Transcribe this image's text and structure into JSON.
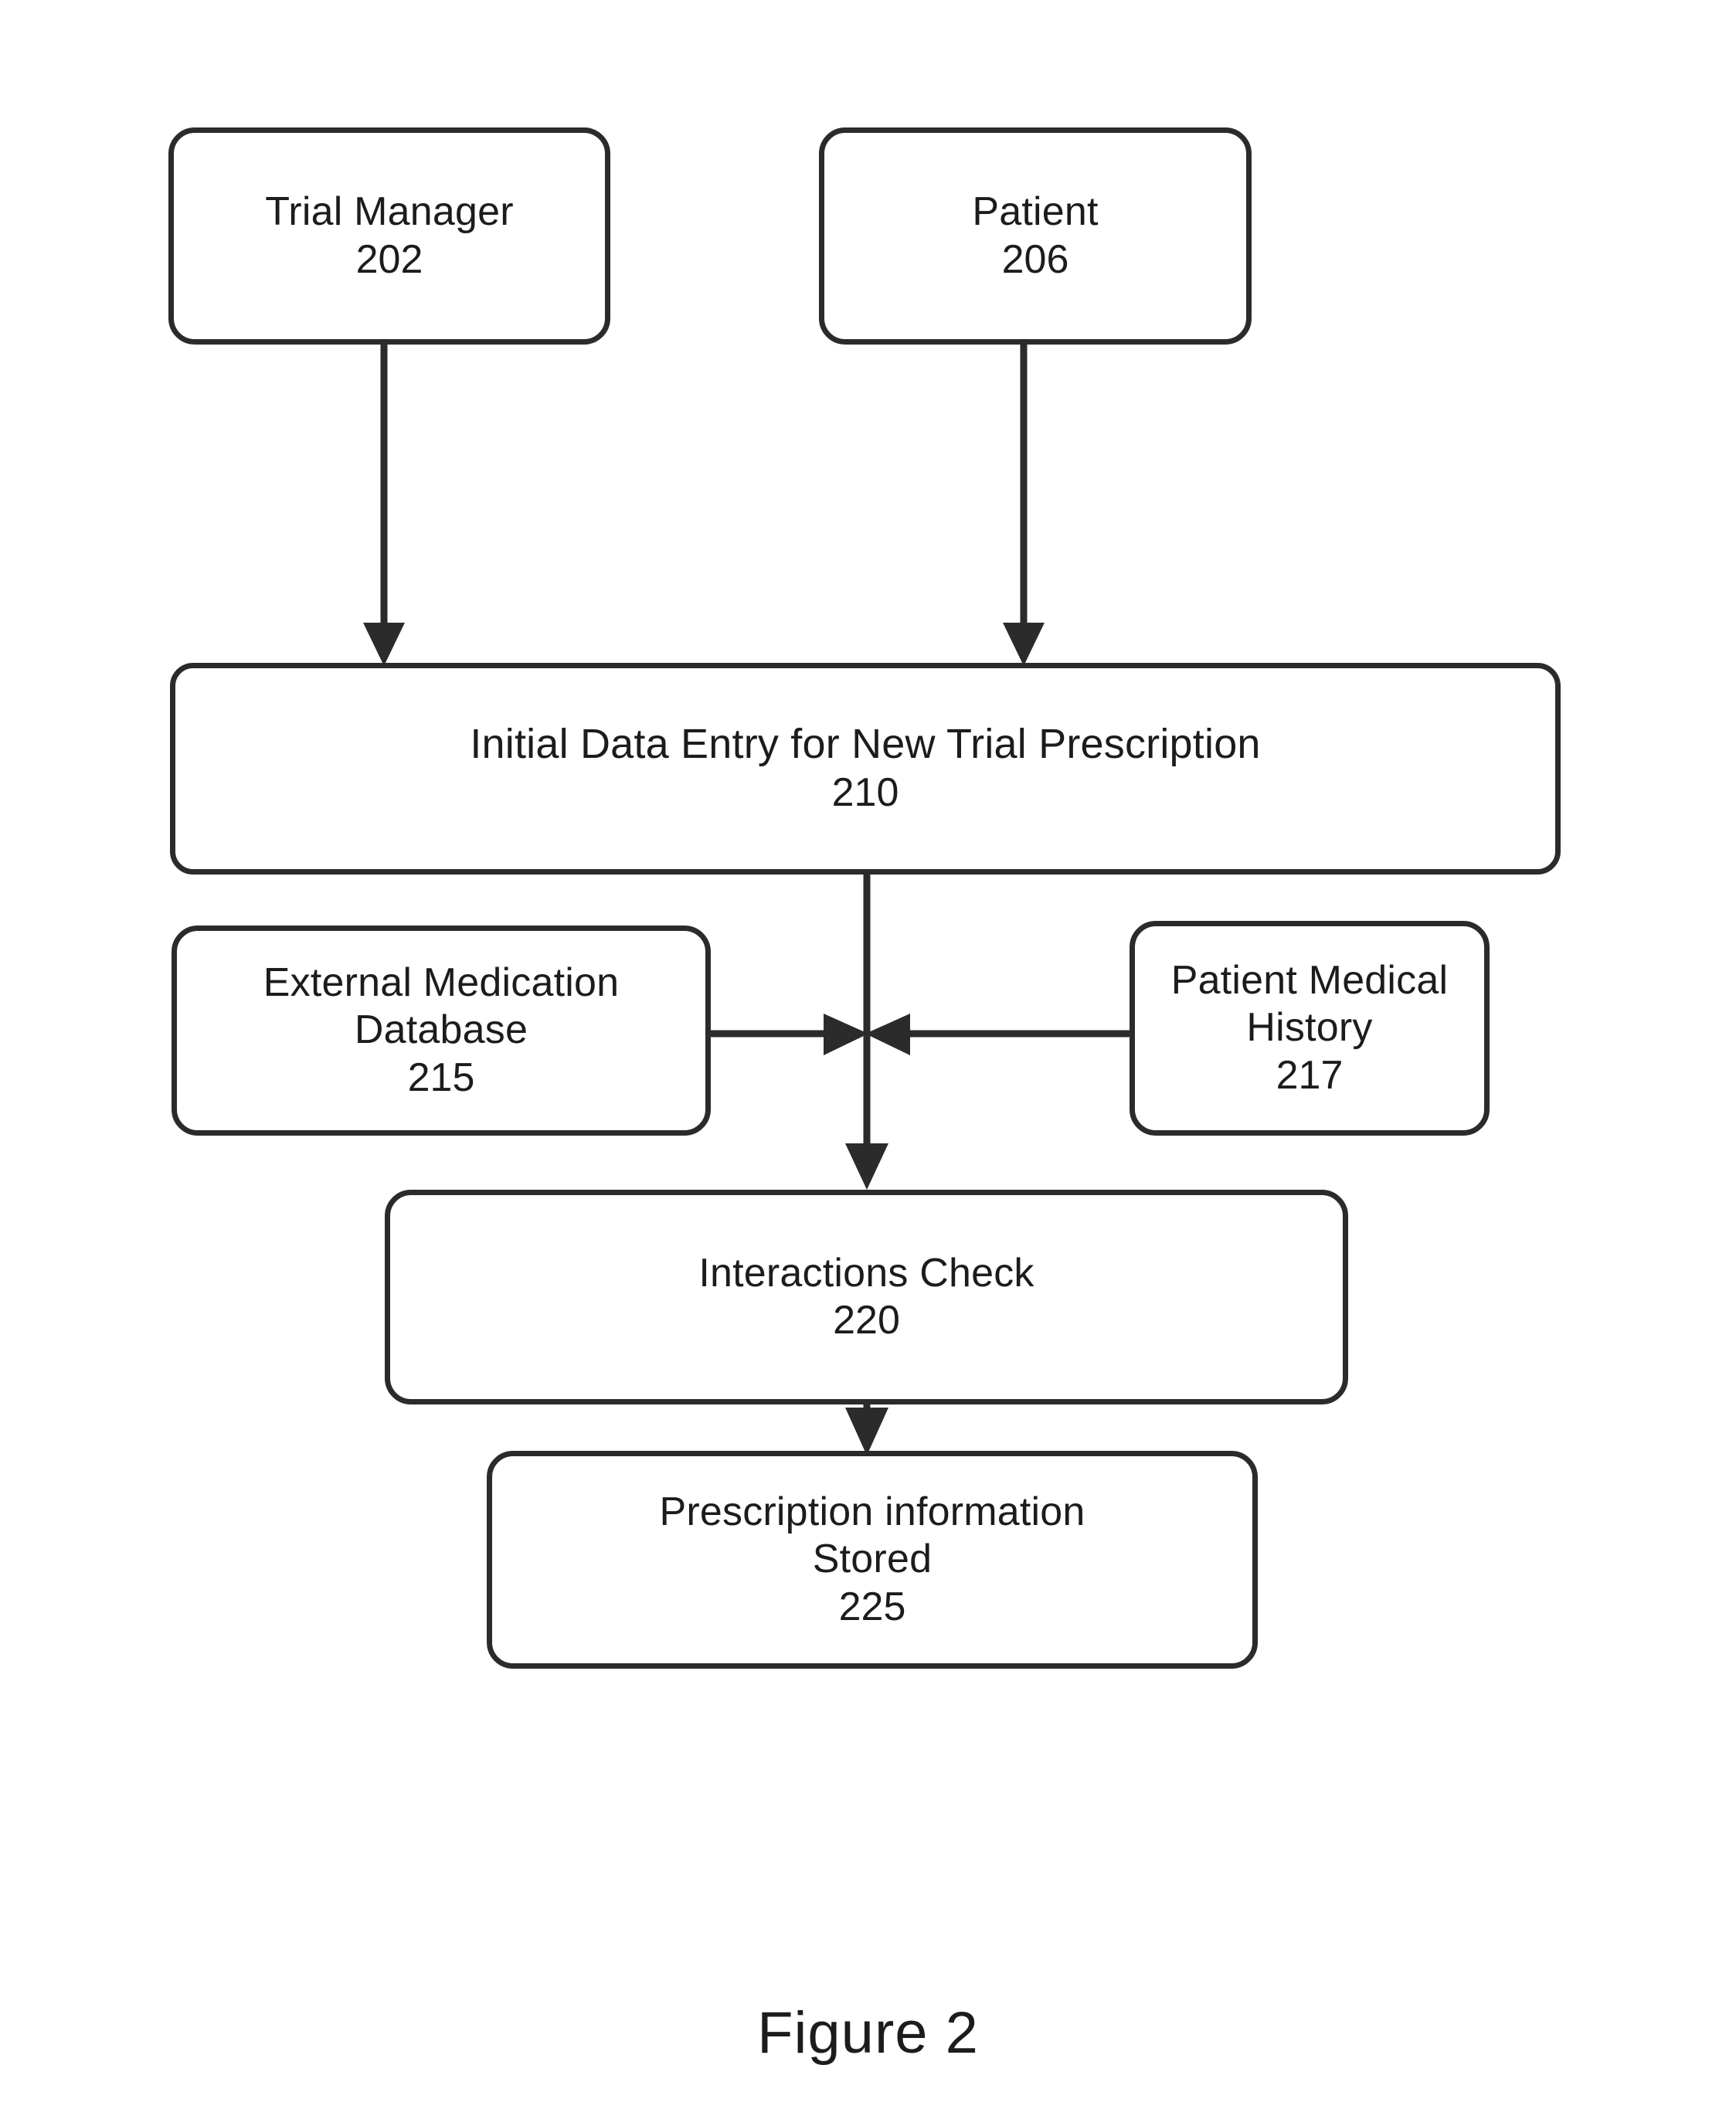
{
  "figure": {
    "caption": "Figure 2",
    "stroke_color": "#2b2b2b",
    "text_color": "#1c1c1c",
    "background_color": "#ffffff"
  },
  "nodes": {
    "trial_manager": {
      "label": "Trial Manager",
      "ref": "202"
    },
    "patient": {
      "label": "Patient",
      "ref": "206"
    },
    "initial_data_entry": {
      "label": "Initial Data Entry for New Trial Prescription",
      "ref": "210"
    },
    "external_medication_database": {
      "line1": "External Medication",
      "line2": "Database",
      "ref": "215"
    },
    "patient_medical_history": {
      "line1": "Patient Medical",
      "line2": "History",
      "ref": "217"
    },
    "interactions_check": {
      "label": "Interactions Check",
      "ref": "220"
    },
    "prescription_stored": {
      "line1": "Prescription information",
      "line2": "Stored",
      "ref": "225"
    }
  },
  "connectors": [
    {
      "name": "trial-manager-to-initial-data-entry",
      "from": "202",
      "to": "210",
      "direction": "down",
      "arrowhead": "end"
    },
    {
      "name": "patient-to-initial-data-entry",
      "from": "206",
      "to": "210",
      "direction": "down",
      "arrowhead": "end"
    },
    {
      "name": "initial-data-entry-to-interactions-check",
      "from": "210",
      "to": "220",
      "direction": "down",
      "arrowhead": "end"
    },
    {
      "name": "external-medication-database-to-junction",
      "from": "215",
      "to": "junction",
      "direction": "right",
      "arrowhead": "end"
    },
    {
      "name": "patient-medical-history-to-junction",
      "from": "217",
      "to": "junction",
      "direction": "left",
      "arrowhead": "end"
    },
    {
      "name": "interactions-check-to-prescription-stored",
      "from": "220",
      "to": "225",
      "direction": "down",
      "arrowhead": "end"
    }
  ]
}
